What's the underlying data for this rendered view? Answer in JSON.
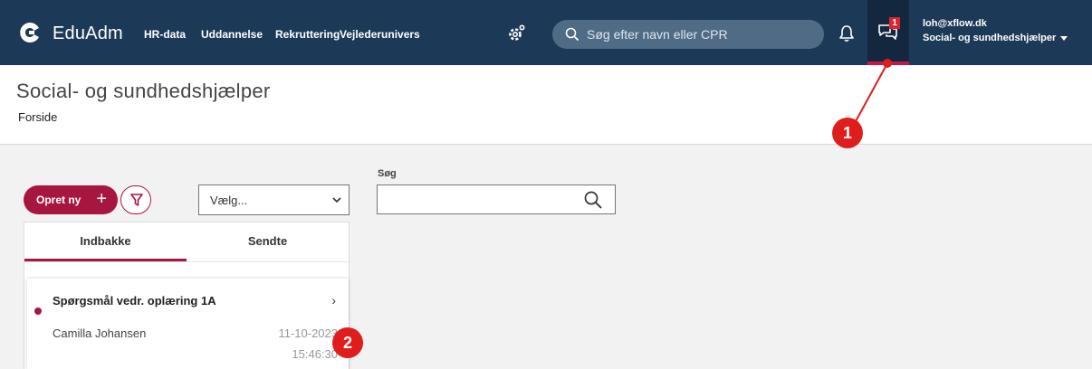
{
  "brand": {
    "name": "EduAdm"
  },
  "nav": {
    "items": [
      {
        "label": "HR-data"
      },
      {
        "label": "Uddannelse"
      },
      {
        "label": "Rekruttering"
      },
      {
        "label": "Vejlederunivers"
      }
    ]
  },
  "top_search": {
    "placeholder": "Søg efter navn eller CPR"
  },
  "messages": {
    "badge_count": "1"
  },
  "user": {
    "email": "loh@xflow.dk",
    "role": "Social- og sundhedshjælper"
  },
  "page": {
    "title": "Social- og sundhedshjælper",
    "breadcrumb": "Forside"
  },
  "toolbar": {
    "new_label": "Opret ny",
    "select_value": "Vælg...",
    "search_label": "Søg",
    "search_value": ""
  },
  "inbox": {
    "tabs": [
      {
        "label": "Indbakke",
        "active": true
      },
      {
        "label": "Sendte",
        "active": false
      }
    ],
    "messages": [
      {
        "subject": "Spørgsmål vedr. oplæring 1A",
        "sender": "Camilla Johansen",
        "date": "11-10-2023",
        "time": "15:46:30",
        "unread": true
      }
    ]
  },
  "annotations": [
    {
      "label": "1"
    },
    {
      "label": "2"
    }
  ],
  "colors": {
    "navbar": "#1c3a57",
    "accent": "#a7163f",
    "marker": "#e01d1d"
  },
  "icons": [
    "logo-icon",
    "gear-icon",
    "search-icon",
    "bell-icon",
    "chat-icon",
    "plus-icon",
    "filter-icon",
    "chevron-down-icon",
    "chevron-right-icon"
  ]
}
